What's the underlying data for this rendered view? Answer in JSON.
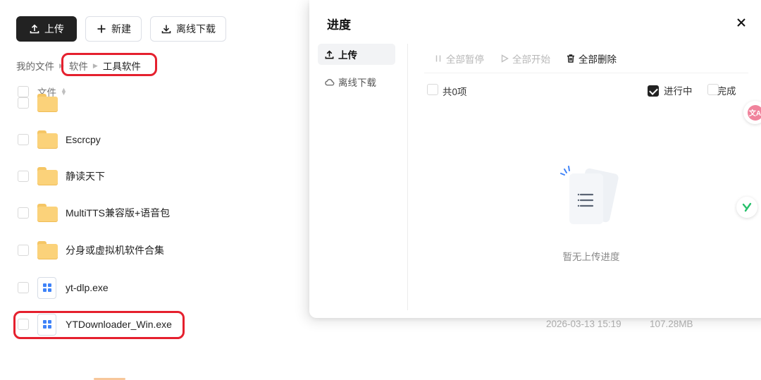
{
  "toolbar": {
    "upload_label": "上传",
    "new_label": "新建",
    "offline_label": "离线下载"
  },
  "breadcrumb": {
    "root": "我的文件",
    "level1": "软件",
    "current": "工具软件"
  },
  "list_header": {
    "column_name": "文件"
  },
  "files": [
    {
      "name": "Escrcpy",
      "type": "folder"
    },
    {
      "name": "静读天下",
      "type": "folder"
    },
    {
      "name": "MultiTTS兼容版+语音包",
      "type": "folder"
    },
    {
      "name": "分身或虚拟机软件合集",
      "type": "folder"
    },
    {
      "name": "yt-dlp.exe",
      "type": "exe"
    },
    {
      "name": "YTDownloader_Win.exe",
      "type": "exe",
      "date": "2026-03-13 15:19",
      "size": "107.28MB"
    }
  ],
  "panel": {
    "title": "进度",
    "nav": {
      "upload": "上传",
      "offline": "离线下载"
    },
    "actions": {
      "pause_all": "全部暂停",
      "start_all": "全部开始",
      "delete_all": "全部删除"
    },
    "summary": {
      "count_label": "共0项",
      "filter_in_progress": "进行中",
      "filter_done": "已完成",
      "in_progress_checked": true,
      "done_checked": false
    },
    "empty_text": "暂无上传进度"
  },
  "colors": {
    "primary_dark": "#222222",
    "highlight_ring": "#e5202e",
    "folder": "#fbd27a",
    "exe_accent": "#3f83f8",
    "translate_badge": "#f0839c",
    "y_badge": "#27c06b"
  }
}
